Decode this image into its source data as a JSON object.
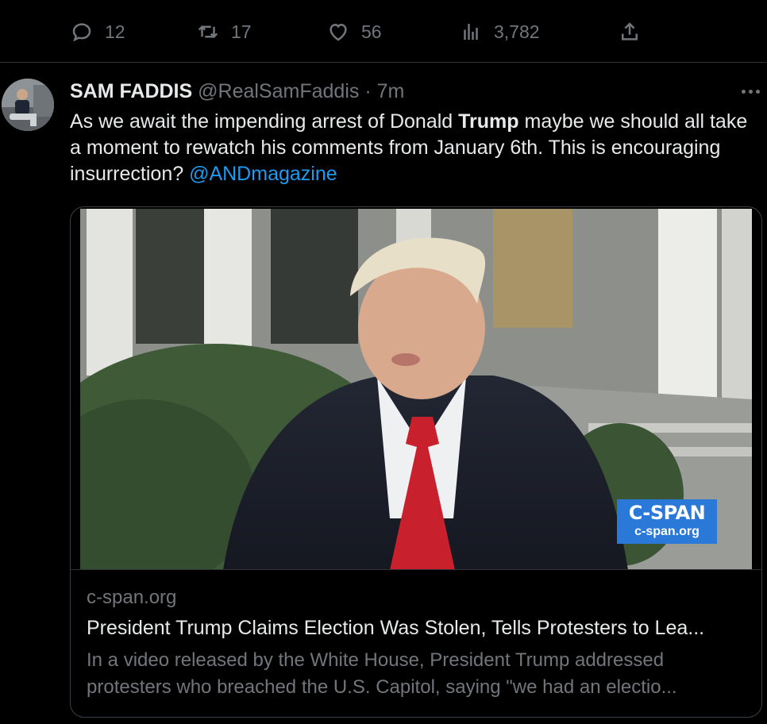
{
  "actions": {
    "reply_count": "12",
    "retweet_count": "17",
    "like_count": "56",
    "views_count": "3,782"
  },
  "tweet": {
    "display_name": "SAM FADDIS",
    "handle": "@RealSamFaddis",
    "separator": "·",
    "time": "7m",
    "text_before": "As we await the impending arrest of Donald ",
    "text_bold": "Trump",
    "text_after": " maybe we should all take a moment to rewatch his comments from January 6th. This is encouraging insurrection? ",
    "mention": "@ANDmagazine"
  },
  "card": {
    "badge_title": "C-SPAN",
    "badge_subtitle": "c-span.org",
    "domain": "c-span.org",
    "title": "President Trump Claims Election Was Stolen, Tells Protesters to Lea...",
    "description_line1": "In a video released by the White House, President Trump addressed",
    "description_line2": "protesters who breached the U.S. Capitol, saying \"we had an electio..."
  },
  "colors": {
    "background": "#000000",
    "text": "#e7e9ea",
    "muted": "#71767b",
    "link": "#1d9bf0",
    "cspan_badge": "#2a78d8",
    "tie": "#c8202d"
  }
}
